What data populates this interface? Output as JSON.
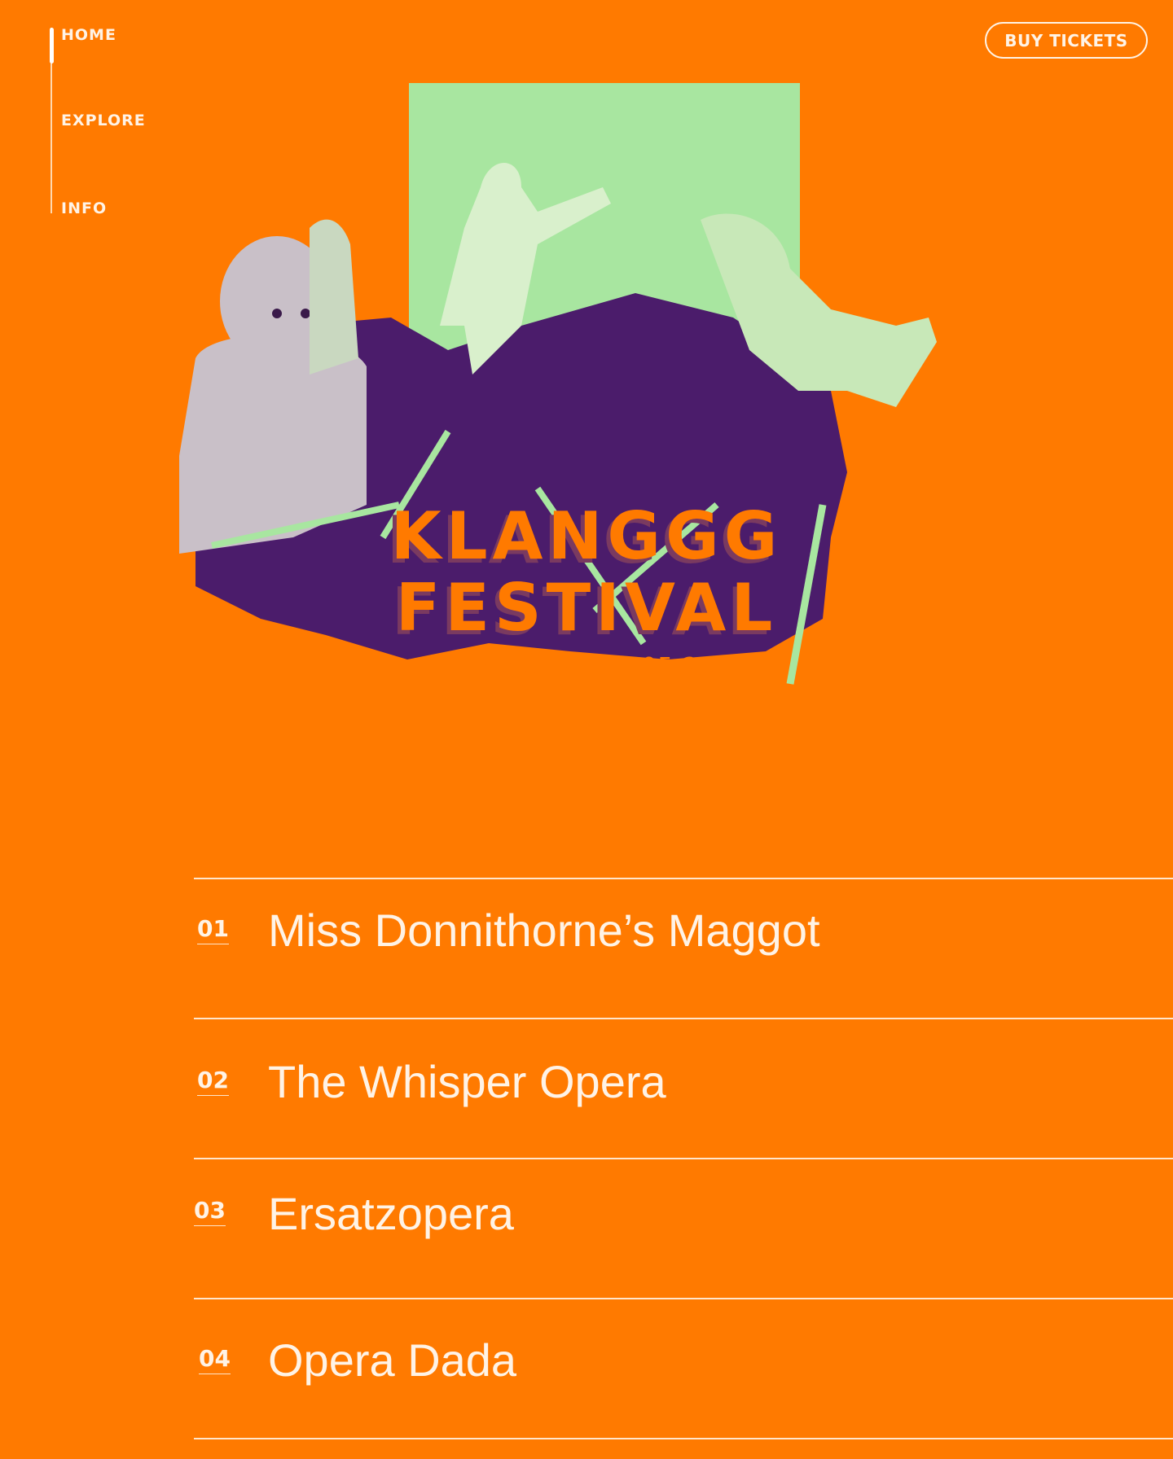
{
  "nav": {
    "items": [
      {
        "label": "HOME",
        "active": true
      },
      {
        "label": "EXPLORE"
      },
      {
        "label": "INFO"
      }
    ]
  },
  "header": {
    "buy_label": "BUY TICKETS"
  },
  "hero": {
    "title_line1": "KLANGGG",
    "title_line2": "FESTIVAL",
    "dates": "05.05.23 - 07.05.23"
  },
  "colors": {
    "background": "#ff7a00",
    "purple": "#4b1c6b",
    "green": "#a8e6a0",
    "text": "#fff3e6"
  },
  "events": [
    {
      "number": "01",
      "title": "Miss Donnithorne’s Maggot"
    },
    {
      "number": "02",
      "title": "The Whisper Opera"
    },
    {
      "number": "03",
      "title": "Ersatzopera"
    },
    {
      "number": "04",
      "title": "Opera Dada"
    }
  ]
}
